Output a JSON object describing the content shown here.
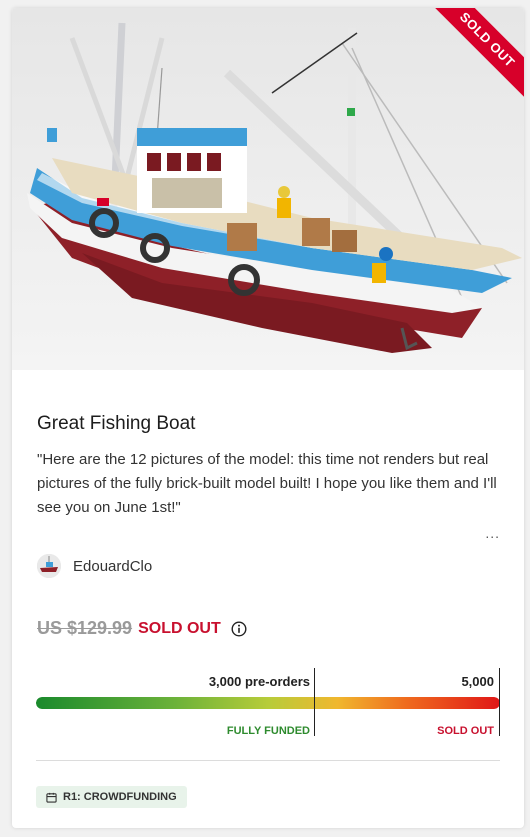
{
  "product": {
    "ribbon": "SOLD OUT",
    "image_alt": "Great Fishing Boat model photo",
    "title": "Great Fishing Boat",
    "description": "\"Here are the 12 pictures of the model: this time not renders but real pictures of the fully brick-built model built! I hope you like them and I'll see you on June 1st!\"",
    "more_label": "..."
  },
  "author": {
    "name": "EdouardClo",
    "avatar_icon": "avatar-boat"
  },
  "price": {
    "old_price": "US $129.99",
    "status": "SOLD OUT",
    "info_icon": "info-icon"
  },
  "progress": {
    "preorders_label": "3,000 pre-orders",
    "goal_label": "5,000",
    "funded_label": "FULLY FUNDED",
    "soldout_label": "SOLD OUT",
    "fill_fraction": 1.0,
    "funded_threshold": 3000,
    "goal": 5000
  },
  "tag": {
    "label": "R1: CROWDFUNDING",
    "icon": "calendar-icon"
  },
  "colors": {
    "sold_out_red": "#c8102e",
    "funded_green": "#2e8b2e",
    "tag_bg": "#e8f3ea"
  }
}
